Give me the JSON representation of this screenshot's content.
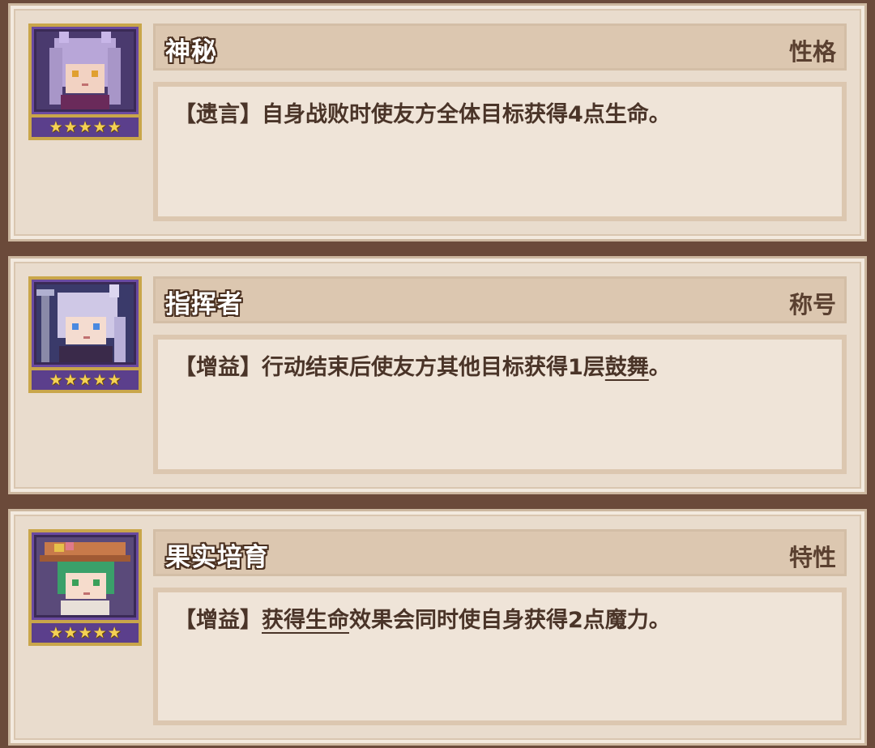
{
  "cards": [
    {
      "name": "神秘",
      "type": "性格",
      "stars": "★★★★★",
      "desc": {
        "pre": "【遗言】自身战败时使友方全体目标获得4点生命。",
        "kw": "",
        "post": ""
      },
      "portrait_palette": {
        "hair": "#b8a6d8",
        "bg": "#4a3a6e",
        "face": "#f2d2c2",
        "eye": "#e0a030",
        "cloth": "#6a2a5a"
      }
    },
    {
      "name": "指挥者",
      "type": "称号",
      "stars": "★★★★★",
      "desc": {
        "pre": "【增益】行动结束后使友方其他目标获得1层",
        "kw": "鼓舞",
        "post": "。"
      },
      "portrait_palette": {
        "hair": "#cfc8e6",
        "bg": "#3a3a6a",
        "face": "#f4dcd0",
        "eye": "#4a8ae0",
        "cloth": "#3a2a4a"
      }
    },
    {
      "name": "果实培育",
      "type": "特性",
      "stars": "★★★★★",
      "desc": {
        "pre": "【增益】",
        "kw": "获得生命",
        "post": "效果会同时使自身获得2点魔力。"
      },
      "portrait_palette": {
        "hair": "#3aa06a",
        "bg": "#5a4a7a",
        "face": "#f6dccc",
        "eye": "#3aa05a",
        "cloth": "#c87a4a"
      }
    }
  ]
}
